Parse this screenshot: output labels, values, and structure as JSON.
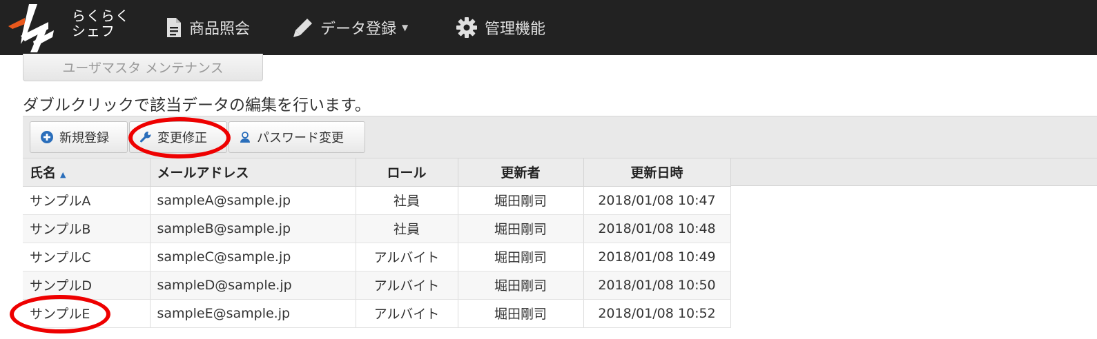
{
  "navbar": {
    "brand_line1": "らくらく",
    "brand_line2": "シェフ",
    "items": [
      {
        "label": "商品照会",
        "icon": "document-icon"
      },
      {
        "label": "データ登録",
        "icon": "pencil-icon"
      },
      {
        "label": "管理機能",
        "icon": "gear-icon"
      }
    ]
  },
  "page": {
    "title_button": "ユーザマスタ メンテナンス",
    "instruction": "ダブルクリックで該当データの編集を行います。"
  },
  "toolbar": {
    "new_label": "新規登録",
    "edit_label": "変更修正",
    "password_label": "パスワード変更"
  },
  "table": {
    "columns": [
      "氏名",
      "メールアドレス",
      "ロール",
      "更新者",
      "更新日時"
    ],
    "sort_indicator": "▲",
    "rows": [
      [
        "サンプルA",
        "sampleA@sample.jp",
        "社員",
        "堀田剛司",
        "2018/01/08 10:47"
      ],
      [
        "サンプルB",
        "sampleB@sample.jp",
        "社員",
        "堀田剛司",
        "2018/01/08 10:48"
      ],
      [
        "サンプルC",
        "sampleC@sample.jp",
        "アルバイト",
        "堀田剛司",
        "2018/01/08 10:49"
      ],
      [
        "サンプルD",
        "sampleD@sample.jp",
        "アルバイト",
        "堀田剛司",
        "2018/01/08 10:50"
      ],
      [
        "サンプルE",
        "sampleE@sample.jp",
        "アルバイト",
        "堀田剛司",
        "2018/01/08 10:52"
      ]
    ]
  },
  "colors": {
    "navbar_bg": "#222222",
    "annotation": "#ee0000",
    "accent_blue": "#2a6ebb",
    "logo_orange": "#e8581c"
  }
}
